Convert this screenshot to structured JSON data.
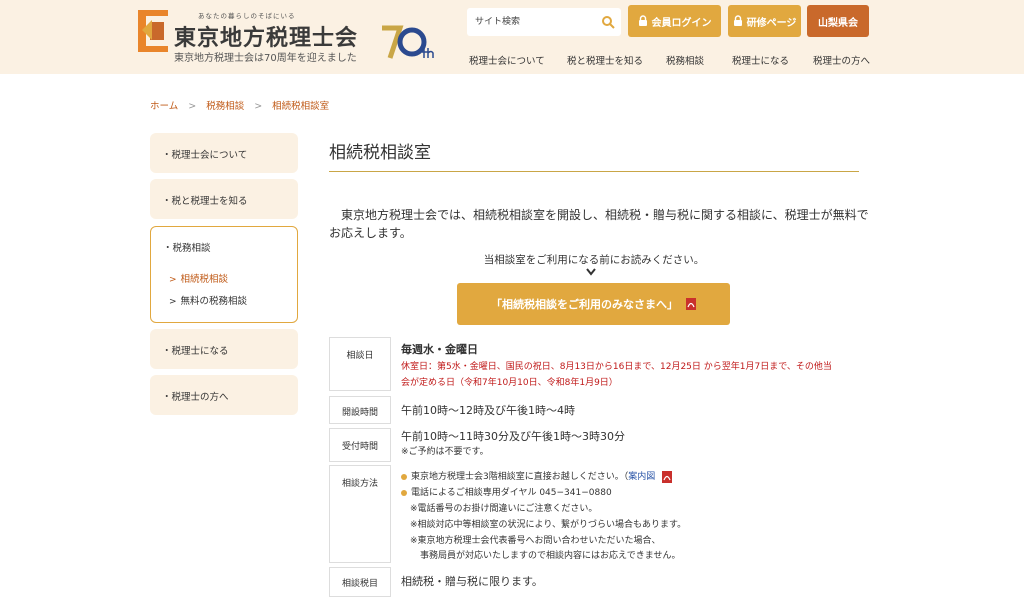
{
  "header": {
    "tagline": "あなたの暮らしのそばにいる",
    "org_name": "東京地方税理士会",
    "anniversary_text": "東京地方税理士会は70周年を迎えました",
    "search_placeholder": "サイト検索",
    "login_label": "会員ログイン",
    "training_label": "研修ページ",
    "chapter_label": "山梨県会",
    "nav": [
      "税理士会について",
      "税と税理士を知る",
      "税務相談",
      "税理士になる",
      "税理士の方へ"
    ]
  },
  "breadcrumb": [
    "ホーム",
    "税務相談",
    "相続税相談室"
  ],
  "sidebar": {
    "items": [
      {
        "label": "・税理士会について"
      },
      {
        "label": "・税と税理士を知る"
      },
      {
        "label": "・税務相談"
      },
      {
        "label": "・税理士になる"
      },
      {
        "label": "・税理士の方へ"
      }
    ],
    "sub_items": [
      {
        "label": "相続税相談",
        "current": true
      },
      {
        "label": "無料の税務相談",
        "current": false
      }
    ]
  },
  "main": {
    "title": "相続税相談室",
    "intro": "　東京地方税理士会では、相続税相談室を開設し、相続税・贈与税に関する相談に、税理士が無料でお応えします。",
    "notice": "当相談室をご利用になる前にお読みください。",
    "pdf_button": "「相続税相談をご利用のみなさまへ」",
    "rows": {
      "date": {
        "label": "相談日",
        "value": "毎週水・金曜日",
        "closed_line1": "休室日：第5水・金曜日、国民の祝日、8月13日から16日まで、12月25日 から翌年1月7日まで、その他当",
        "closed_line2": "会が定める日（令和7年10月10日、令和8年1月9日）"
      },
      "hours": {
        "label": "開設時間",
        "value": "午前10時～12時及び午後1時～4時"
      },
      "reception": {
        "label": "受付時間",
        "value": "午前10時～11時30分及び午後1時～3時30分",
        "note": "※ご予約は不要です。"
      },
      "method": {
        "label": "相談方法",
        "item1": "東京地方税理士会3階相談室に直接お越しください。（",
        "item1_link": "案内図",
        "item2": "電話によるご相談専用ダイヤル 045−341−0880",
        "warning": "※電話番号のお掛け間違いにご注意ください。",
        "note1": "※相談対応中等相談室の状況により、繋がりづらい場合もあります。",
        "note2": "※東京地方税理士会代表番号へお問い合わせいただいた場合、",
        "note3": "事務局員が対応いたしますので相談内容にはお応えできません。"
      },
      "subject": {
        "label": "相談税目",
        "value": "相続税・贈与税に限ります。"
      }
    }
  },
  "colors": {
    "accent": "#e1a83f",
    "accent_dark": "#c9692b",
    "link_orange": "#c05a17",
    "red": "#c01a1a",
    "header_bg": "#fbf1e3"
  },
  "icons": [
    "search-icon",
    "lock-icon",
    "pdf-icon",
    "chevron-right-icon",
    "chevron-down-icon"
  ]
}
